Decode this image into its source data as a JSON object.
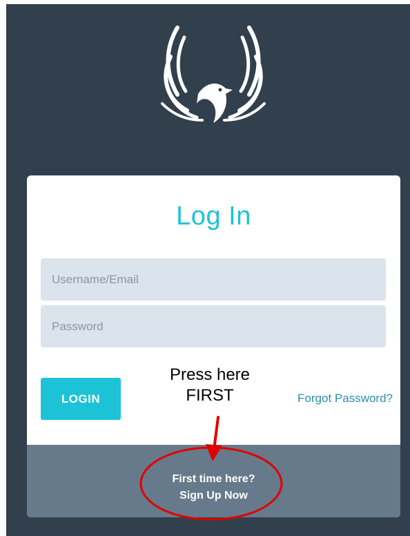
{
  "login": {
    "title": "Log In",
    "username_placeholder": "Username/Email",
    "password_placeholder": "Password",
    "login_button": "LOGIN",
    "forgot_password": "Forgot Password?",
    "signup_line1": "First time here?",
    "signup_line2": "Sign Up Now"
  },
  "annotation": {
    "line1": "Press here",
    "line2": "FIRST"
  },
  "colors": {
    "background": "#323f4d",
    "accent": "#1cc3d6",
    "footer": "#677a8b",
    "input_bg": "#dbe3ec",
    "link": "#2a90a8",
    "annotation": "#e00000"
  },
  "icons": {
    "logo": "phoenix-logo-icon"
  }
}
